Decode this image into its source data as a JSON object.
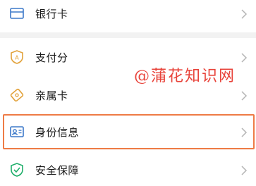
{
  "menu": {
    "items": [
      {
        "label": "银行卡",
        "icon": "bank-card-icon"
      },
      {
        "label": "支付分",
        "icon": "pay-score-icon"
      },
      {
        "label": "亲属卡",
        "icon": "family-card-icon"
      },
      {
        "label": "身份信息",
        "icon": "id-card-icon"
      },
      {
        "label": "安全保障",
        "icon": "shield-icon"
      }
    ]
  },
  "watermark": "@蒲花知识网",
  "colors": {
    "highlight": "#ee7b45",
    "watermark": "#e8433a",
    "blue_icon": "#3b78c9",
    "gold_icon": "#e2a23a",
    "green_icon": "#1fae6a"
  }
}
